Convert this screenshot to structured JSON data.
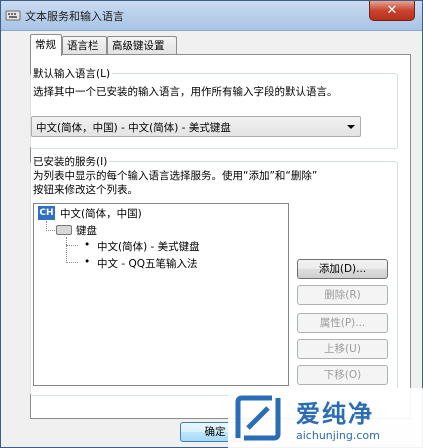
{
  "window": {
    "title": "文本服务和输入语言",
    "close_glyph": "✕"
  },
  "tabs": [
    {
      "label": "常规",
      "active": true
    },
    {
      "label": "语言栏",
      "active": false
    },
    {
      "label": "高级键设置",
      "active": false
    }
  ],
  "default_lang": {
    "group_label": "默认输入语言(L)",
    "description": "选择其中一个已安装的输入语言，用作所有输入字段的默认语言。",
    "selected": "中文(简体，中国) - 中文(简体) - 美式键盘"
  },
  "services": {
    "group_label": "已安装的服务(I)",
    "description_line1": "为列表中显示的每个输入语言选择服务。使用“添加”和“删除”",
    "description_line2": "按钮来修改这个列表。",
    "tree": {
      "language": "中文(简体，中国)",
      "language_badge": "CH",
      "category": "键盘",
      "items": [
        "中文(简体) - 美式键盘",
        "中文 - QQ五笔输入法"
      ]
    },
    "buttons": {
      "add": "添加(D)...",
      "remove": "删除(R)",
      "properties": "属性(P)...",
      "move_up": "上移(U)",
      "move_down": "下移(O)"
    }
  },
  "footer": {
    "ok": "确定"
  },
  "watermark": {
    "brand": "爱纯净",
    "url": "aichunjing.com"
  },
  "colors": {
    "titlebar": "#b5cdeb",
    "close": "#c7432f",
    "badge": "#2f6fc4",
    "watermark": "#2b6cb8"
  }
}
